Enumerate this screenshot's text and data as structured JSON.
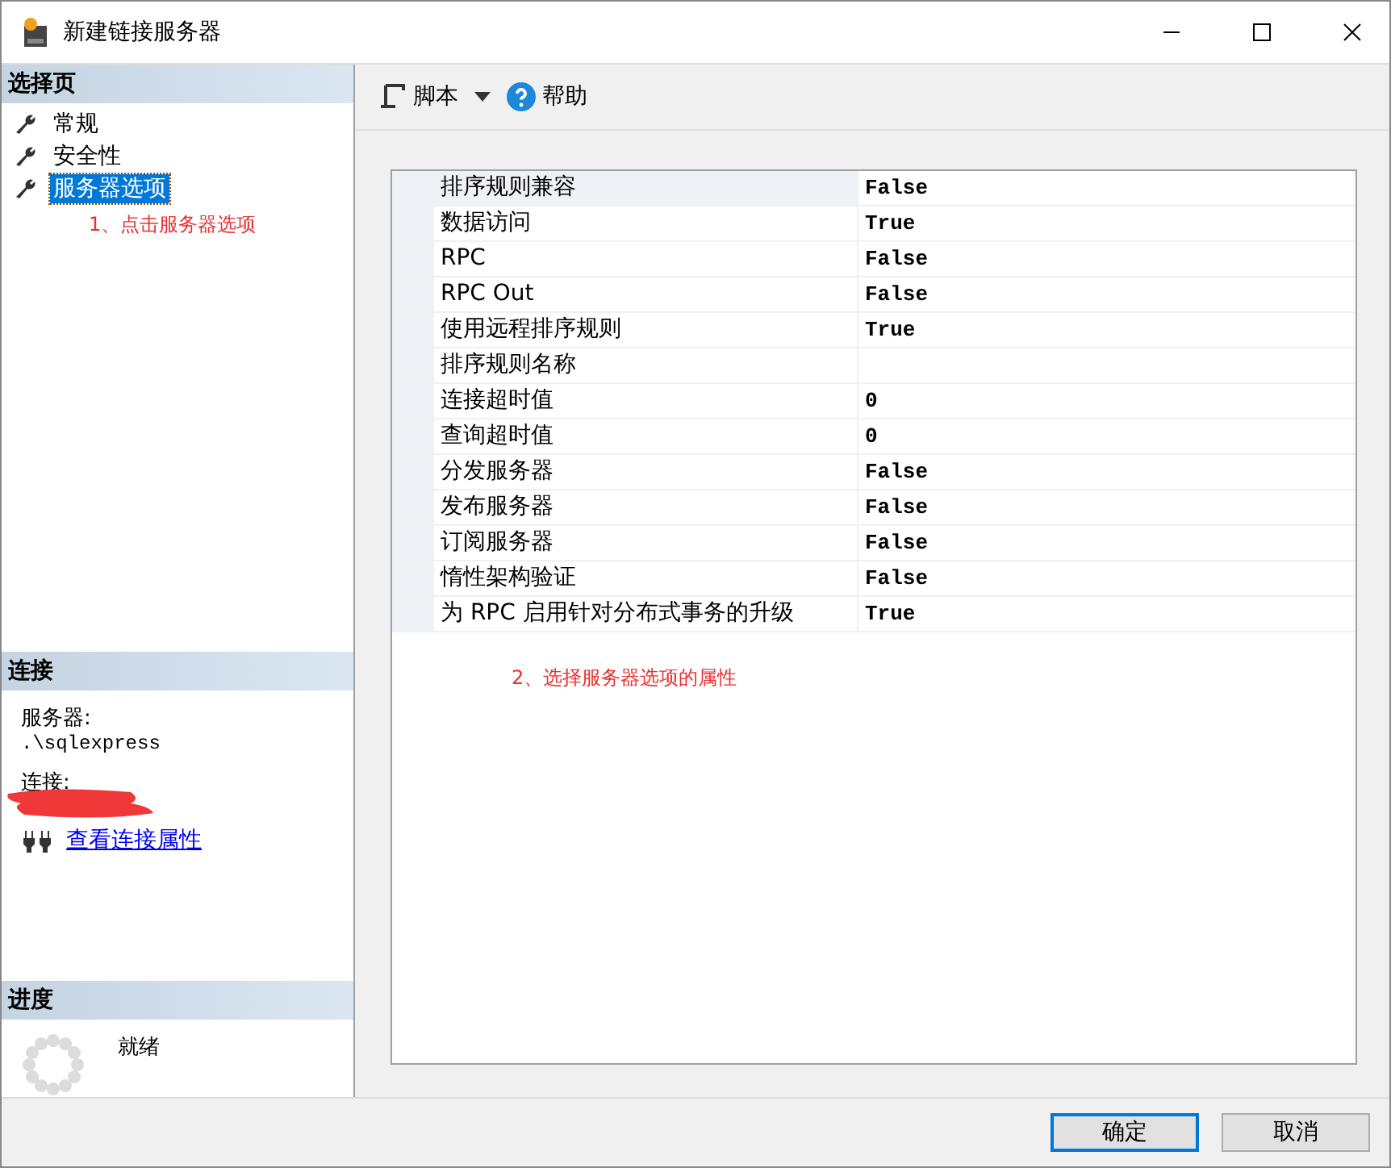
{
  "window": {
    "title": "新建链接服务器"
  },
  "sidebar": {
    "heading": "选择页",
    "items": [
      {
        "label": "常规",
        "selected": false
      },
      {
        "label": "安全性",
        "selected": false
      },
      {
        "label": "服务器选项",
        "selected": true
      }
    ],
    "annotation": "1、点击服务器选项"
  },
  "connection": {
    "heading": "连接",
    "server_label": "服务器:",
    "server": ".\\sqlexpress",
    "connection_label": "连接:",
    "redacted": true,
    "link": "查看连接属性"
  },
  "progress": {
    "heading": "进度",
    "status": "就绪"
  },
  "toolbar": {
    "script": "脚本",
    "help": "帮助"
  },
  "properties": {
    "rows": [
      {
        "name": "排序规则兼容",
        "value": "False",
        "selected": true
      },
      {
        "name": "数据访问",
        "value": "True",
        "selected": false
      },
      {
        "name": "RPC",
        "value": "False",
        "selected": false
      },
      {
        "name": "RPC Out",
        "value": "False",
        "selected": false
      },
      {
        "name": "使用远程排序规则",
        "value": "True",
        "selected": false
      },
      {
        "name": "排序规则名称",
        "value": "",
        "selected": false
      },
      {
        "name": "连接超时值",
        "value": "0",
        "selected": false
      },
      {
        "name": "查询超时值",
        "value": "0",
        "selected": false
      },
      {
        "name": "分发服务器",
        "value": "False",
        "selected": false
      },
      {
        "name": "发布服务器",
        "value": "False",
        "selected": false
      },
      {
        "name": "订阅服务器",
        "value": "False",
        "selected": false
      },
      {
        "name": "惰性架构验证",
        "value": "False",
        "selected": false
      },
      {
        "name": "为 RPC 启用针对分布式事务的升级",
        "value": "True",
        "selected": false
      }
    ],
    "annotation": "2、选择服务器选项的属性"
  },
  "buttons": [
    {
      "label": "确定",
      "default": true
    },
    {
      "label": "取消",
      "default": false
    }
  ]
}
